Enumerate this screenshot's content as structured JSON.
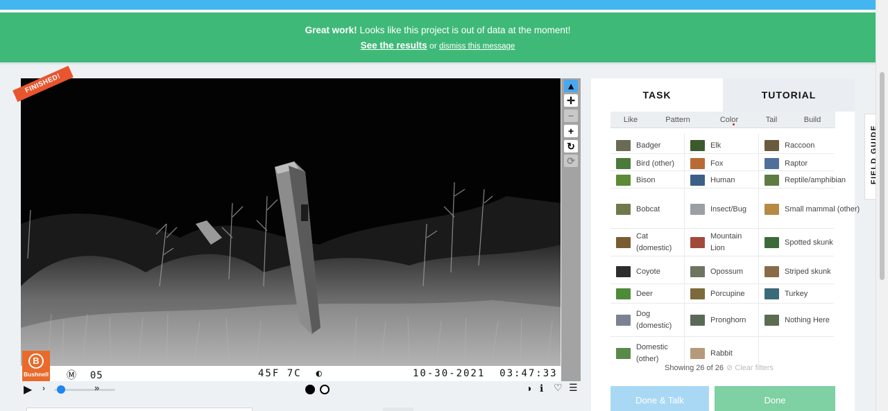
{
  "banner": {
    "great": "Great work!",
    "message": "Looks like this project is out of data at the moment!",
    "see_results": "See the results",
    "or": "or",
    "dismiss": "dismiss this message"
  },
  "viewer": {
    "finished_label": "FINISHED!",
    "camera_brand": "Bushnell",
    "moon_glyph": "Ⓜ",
    "camera_no": "05",
    "temperature": "45F 7C",
    "date": "10-30-2021",
    "time": "03:47:33"
  },
  "tabs": {
    "task": "TASK",
    "tutorial": "TUTORIAL"
  },
  "filters": [
    "Like",
    "Pattern",
    "Color",
    "Tail",
    "Build"
  ],
  "choices": [
    {
      "label": "Badger",
      "color": "#6b6a55"
    },
    {
      "label": "Elk",
      "color": "#3c5a2c"
    },
    {
      "label": "Raccoon",
      "color": "#6a5a3e"
    },
    {
      "label": "Bird (other)",
      "color": "#4b7a3a"
    },
    {
      "label": "Fox",
      "color": "#b86b35"
    },
    {
      "label": "Raptor",
      "color": "#4f6f9a"
    },
    {
      "label": "Bison",
      "color": "#5c8a35"
    },
    {
      "label": "Human",
      "color": "#3b5f86"
    },
    {
      "label": "Reptile/amphibian",
      "color": "#5f7b44"
    },
    {
      "label": "Bobcat",
      "color": "#6f7a4c"
    },
    {
      "label": "Insect/Bug",
      "color": "#9aa0a4"
    },
    {
      "label": "Small mammal (other)",
      "color": "#b48a45"
    },
    {
      "label": "Cat (domestic)",
      "color": "#7a5c32"
    },
    {
      "label": "Mountain Lion",
      "color": "#a24a3a"
    },
    {
      "label": "Spotted skunk",
      "color": "#3d6a3a"
    },
    {
      "label": "Coyote",
      "color": "#2d2d2d"
    },
    {
      "label": "Opossum",
      "color": "#6d7560"
    },
    {
      "label": "Striped skunk",
      "color": "#8a6a48"
    },
    {
      "label": "Deer",
      "color": "#4f8a3a"
    },
    {
      "label": "Porcupine",
      "color": "#7c6a3c"
    },
    {
      "label": "Turkey",
      "color": "#3a6a7a"
    },
    {
      "label": "Dog (domestic)",
      "color": "#7b8290"
    },
    {
      "label": "Pronghorn",
      "color": "#5b6a58"
    },
    {
      "label": "Nothing Here",
      "color": "#5c6b52"
    },
    {
      "label": "Domestic (other)",
      "color": "#5a8a4a"
    },
    {
      "label": "Rabbit",
      "color": "#b59a7a"
    }
  ],
  "showing": "Showing 26 of 26",
  "clear_filters": "⊘ Clear filters",
  "buttons": {
    "done_talk": "Done & Talk",
    "done": "Done"
  },
  "field_guide": "FIELD GUIDE"
}
